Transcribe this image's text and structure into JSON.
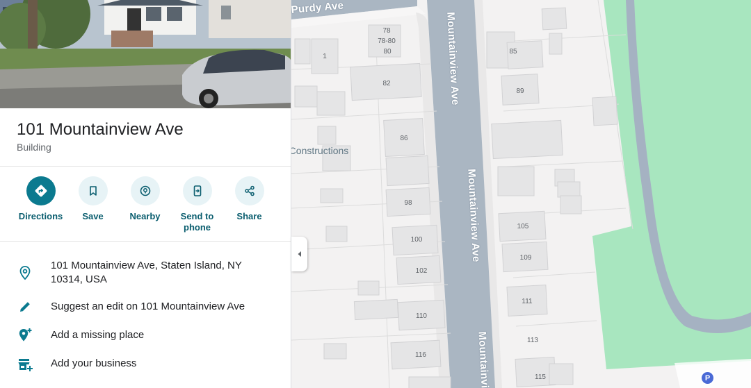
{
  "place": {
    "title": "101 Mountainview Ave",
    "category": "Building"
  },
  "actions": [
    {
      "label": "Directions",
      "icon": "directions-icon"
    },
    {
      "label": "Save",
      "icon": "bookmark-icon"
    },
    {
      "label": "Nearby",
      "icon": "nearby-icon"
    },
    {
      "label": "Send to phone",
      "icon": "send-to-phone-icon"
    },
    {
      "label": "Share",
      "icon": "share-icon"
    }
  ],
  "info": {
    "address": "101 Mountainview Ave, Staten Island, NY 10314, USA",
    "suggest_edit": "Suggest an edit on 101 Mountainview Ave",
    "add_missing": "Add a missing place",
    "add_business": "Add your business"
  },
  "map": {
    "streets": {
      "purdy": "Purdy Ave",
      "mountainview_1": "Mountainview Ave",
      "mountainview_2": "Mountainview Ave",
      "mountainview_3": "Mountainvi"
    },
    "poi": "e Constructions",
    "parking_label": "P",
    "lots": [
      "78",
      "78-80",
      "80",
      "1",
      "82",
      "86",
      "98",
      "100",
      "102",
      "110",
      "116",
      "85",
      "89",
      "105",
      "109",
      "111",
      "113",
      "115"
    ]
  },
  "colors": {
    "accent": "#0b7a8f",
    "accent_light": "#e7f3f6",
    "park": "#a8e6bf",
    "road": "#aab6c2",
    "pin": "#ea4335",
    "parking": "#4a6ad6"
  }
}
